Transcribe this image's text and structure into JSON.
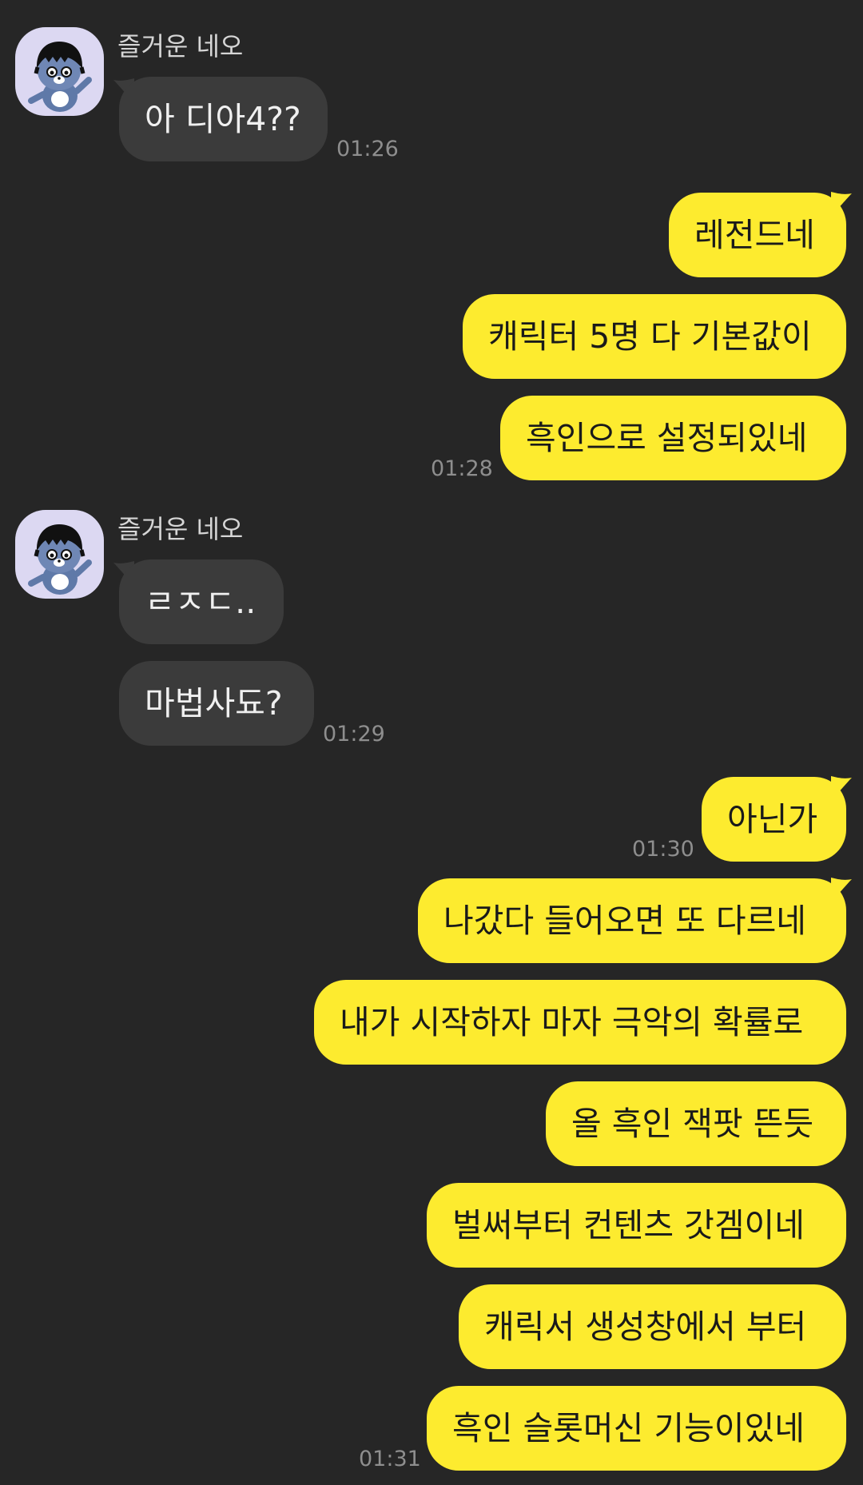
{
  "chat": {
    "groups": [
      {
        "sender": "즐거운 네오",
        "messages": [
          "아 디아4??"
        ],
        "time": "01:26"
      },
      {
        "messages": [
          "레전드네",
          "캐릭터 5명 다 기본값이",
          "흑인으로 설정되있네"
        ],
        "time": "01:28"
      },
      {
        "sender": "즐거운 네오",
        "messages": [
          "ㄹㅈㄷ..",
          "마법사됴?"
        ],
        "time": "01:29"
      },
      {
        "messages": [
          "아닌가"
        ],
        "time": "01:30"
      },
      {
        "messages": [
          "나갔다 들어오면 또 다르네",
          "내가 시작하자 마자 극악의 확률로",
          "올 흑인 잭팟 뜬듯",
          "벌써부터 컨텐츠 갓겜이네",
          "캐릭서 생성창에서 부터",
          "흑인 슬롯머신 기능이있네"
        ],
        "time": "01:31"
      }
    ]
  },
  "colors": {
    "background": "#262626",
    "incoming_bubble": "#3b3b3b",
    "outgoing_bubble": "#fdeb2f",
    "avatar_bg": "#dcd8f2"
  }
}
